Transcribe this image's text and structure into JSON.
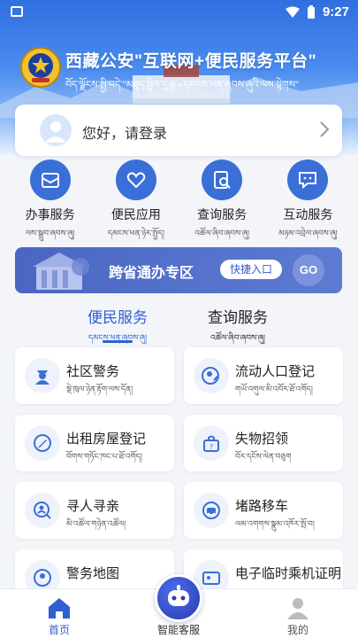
{
  "status_bar": {
    "time": "9:27"
  },
  "header": {
    "title": "西藏公安\"互联网+便民服务平台\"",
    "title_tibetan": "བོད་ལྗོངས་སྤྱི་བདེ་\"མཐུད་སྦྲེལ་དྲ་རྒྱ་+དམངས་ཕན་ཞབས་ཞུའི་ལས་སྟེགས\""
  },
  "login": {
    "prompt": "您好，请登录"
  },
  "main_services": [
    {
      "label": "办事服务",
      "tibetan": "ལས་སྒྲུབ་ཞབས་ཞུ།",
      "icon": "briefcase-icon"
    },
    {
      "label": "便民应用",
      "tibetan": "དམངས་ཕན་ཉེར་སྤྱོད།",
      "icon": "heart-icon"
    },
    {
      "label": "查询服务",
      "tibetan": "འཚོལ་ཞིབ་ཞབས་ཞུ།",
      "icon": "search-document-icon"
    },
    {
      "label": "互动服务",
      "tibetan": "མཉམ་འབྲེལ་ཞབས་ཞུ།",
      "icon": "chat-icon"
    }
  ],
  "banner": {
    "title": "跨省通办专区",
    "quick_entry": "快捷入口",
    "go": "GO"
  },
  "tabs": [
    {
      "label": "便民服务",
      "tibetan": "དམངས་ཕན་ཞབས་ཞུ།",
      "active": true
    },
    {
      "label": "查询服务",
      "tibetan": "འཚོལ་ཞིབ་ཞབས་ཞུ།",
      "active": false
    }
  ],
  "services": [
    {
      "label": "社区警务",
      "tibetan": "སྡེ་ཁུལ་ཉེན་རྟོག་ལས་དོན།",
      "icon": "police-officer-icon"
    },
    {
      "label": "流动人口登记",
      "tibetan": "གཡོ་འགུལ་མི་འབོར་ཐོ་འགོད།",
      "icon": "person-edit-icon"
    },
    {
      "label": "出租房屋登记",
      "tibetan": "བོགས་གཏོང་ཁང་པ་ཐོ་འགོད།",
      "icon": "house-edit-icon"
    },
    {
      "label": "失物招领",
      "tibetan": "བོར་དངོས་ལེན་བཅུག",
      "icon": "lost-found-icon"
    },
    {
      "label": "寻人寻亲",
      "tibetan": "མི་འཚོལ་གཉེན་འཚོལ།",
      "icon": "search-person-icon"
    },
    {
      "label": "堵路移车",
      "tibetan": "ལམ་འགགས་སྣུམ་འཁོར་སྤོ་བ།",
      "icon": "car-icon"
    },
    {
      "label": "警务地图",
      "tibetan": "",
      "icon": "map-icon"
    },
    {
      "label": "电子临时乘机证明",
      "tibetan": "",
      "icon": "id-card-icon"
    }
  ],
  "bottom_nav": [
    {
      "label": "首页",
      "icon": "home-icon",
      "active": true
    },
    {
      "label": "智能客服",
      "icon": "robot-icon",
      "active": false
    },
    {
      "label": "我的",
      "icon": "user-icon",
      "active": false
    }
  ],
  "colors": {
    "primary": "#2f5fd0",
    "icon_circle": "#3a6fd8",
    "banner": "#4a66c2"
  }
}
